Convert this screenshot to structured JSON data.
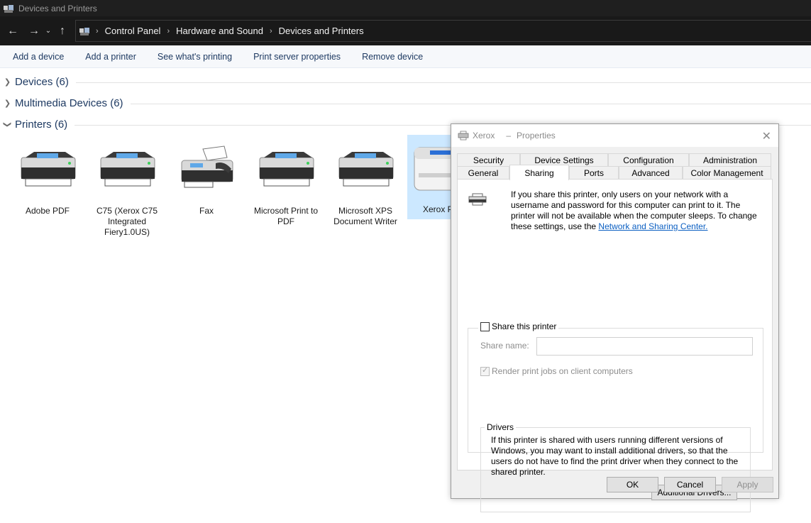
{
  "window": {
    "title": "Devices and Printers"
  },
  "address": {
    "breadcrumbs": [
      "Control Panel",
      "Hardware and Sound",
      "Devices and Printers"
    ]
  },
  "commands": [
    "Add a device",
    "Add a printer",
    "See what's printing",
    "Print server properties",
    "Remove device"
  ],
  "groups": [
    {
      "title": "Devices (6)",
      "expanded": false
    },
    {
      "title": "Multimedia Devices (6)",
      "expanded": false
    },
    {
      "title": "Printers (6)",
      "expanded": true
    }
  ],
  "printers": [
    {
      "name": "Adobe PDF",
      "icon": "printer-icon"
    },
    {
      "name": "C75 (Xerox C75 Integrated Fiery1.0US)",
      "icon": "printer-icon"
    },
    {
      "name": "Fax",
      "icon": "fax-icon"
    },
    {
      "name": "Microsoft Print to PDF",
      "icon": "printer-icon"
    },
    {
      "name": "Microsoft XPS Document Writer",
      "icon": "printer-icon"
    },
    {
      "name": "Xerox P",
      "icon": "printer-icon",
      "selected": true
    }
  ],
  "dialog": {
    "printer_name": "Xerox",
    "title_suffix": "Properties",
    "tabs_back": [
      "Security",
      "Device Settings",
      "Configuration",
      "Administration"
    ],
    "tabs_front": [
      "General",
      "Sharing",
      "Ports",
      "Advanced",
      "Color Management"
    ],
    "active_tab": "Sharing",
    "info_text": "If you share this printer, only users on your network with a username and password for this computer can print to it. The printer will not be available when the computer sleeps. To change these settings, use the ",
    "info_link": "Network and Sharing Center.",
    "share_checkbox_label": "Share this printer",
    "share_checked": false,
    "share_name_label": "Share name:",
    "share_name_value": "",
    "render_label": "Render print jobs on client computers",
    "render_checked": true,
    "drivers_label": "Drivers",
    "drivers_text": "If this printer is shared with users running different versions of Windows, you may want to install additional drivers, so that the users do not have to find the print driver when they connect to the shared printer.",
    "additional_drivers_button": "Additional Drivers...",
    "ok_button": "OK",
    "cancel_button": "Cancel",
    "apply_button": "Apply"
  },
  "colors": {
    "link_blue": "#1e3a62",
    "hyperlink": "#0b5fc2",
    "selection": "#cce8ff",
    "dark_chrome": "#191919"
  }
}
